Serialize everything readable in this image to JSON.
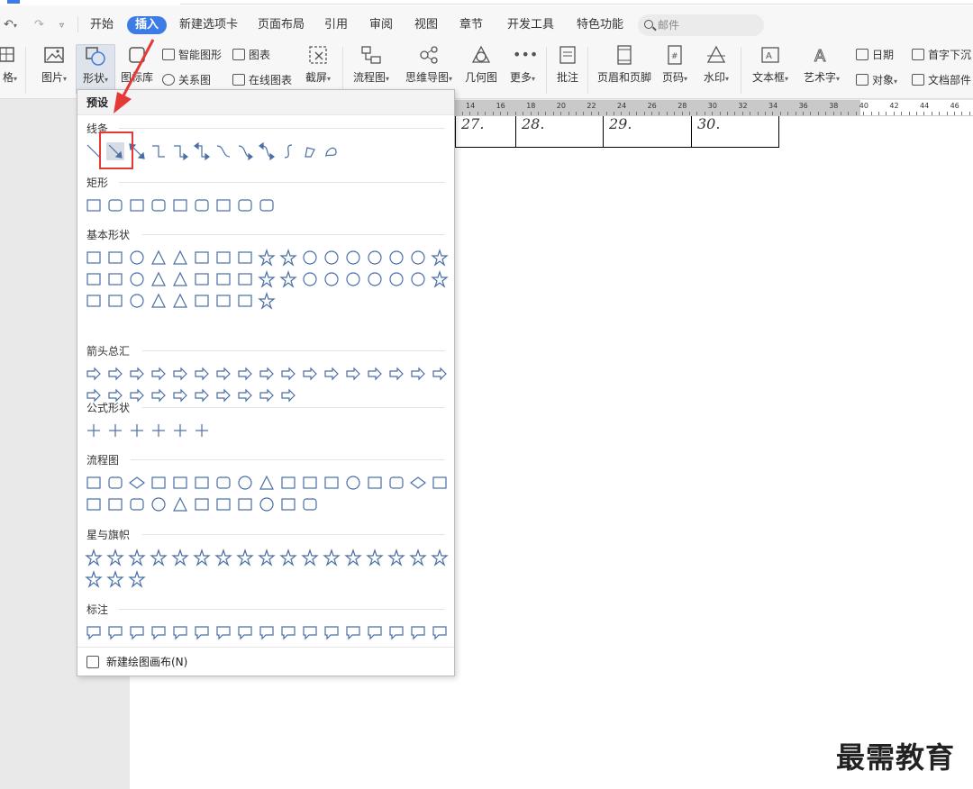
{
  "menubar": {
    "items": [
      "开始",
      "插入",
      "新建选项卡",
      "页面布局",
      "引用",
      "审阅",
      "视图",
      "章节",
      "开发工具",
      "特色功能"
    ],
    "active": "插入",
    "search_placeholder": "邮件"
  },
  "toolbar": {
    "table_partial": "格",
    "picture": "图片",
    "shapes": "形状",
    "icon_lib_partial": "图标库",
    "smart_graphic": "智能图形",
    "chart": "图表",
    "relation_graph": "关系图",
    "online_chart": "在线图表",
    "screenshot": "截屏",
    "flowchart": "流程图",
    "mindmap": "思维导图",
    "geometry": "几何图",
    "more": "更多",
    "comment": "批注",
    "header_footer": "页眉和页脚",
    "page_number": "页码",
    "watermark": "水印",
    "text_box": "文本框",
    "art_text": "艺术字",
    "date": "日期",
    "drop_cap": "首字下沉",
    "object": "对象",
    "doc_parts": "文档部件"
  },
  "ruler": {
    "numbers": [
      "14",
      "16",
      "18",
      "20",
      "22",
      "24",
      "26",
      "28",
      "30",
      "32",
      "34",
      "36",
      "38",
      "40",
      "42",
      "44",
      "46"
    ]
  },
  "document": {
    "cells": [
      "27.",
      "28.",
      "29.",
      "30."
    ]
  },
  "dropdown": {
    "header": "预设",
    "categories": {
      "lines": "线条",
      "rect": "矩形",
      "basic": "基本形状",
      "arrows": "箭头总汇",
      "formula": "公式形状",
      "flowchart": "流程图",
      "stars": "星与旗帜",
      "callouts": "标注"
    },
    "footer": "新建绘图画布(N)"
  },
  "watermark_text": "最需教育",
  "colors": {
    "accent": "#3d7be6",
    "shape_stroke": "#4a6fa5",
    "highlight_red": "#e53935"
  }
}
